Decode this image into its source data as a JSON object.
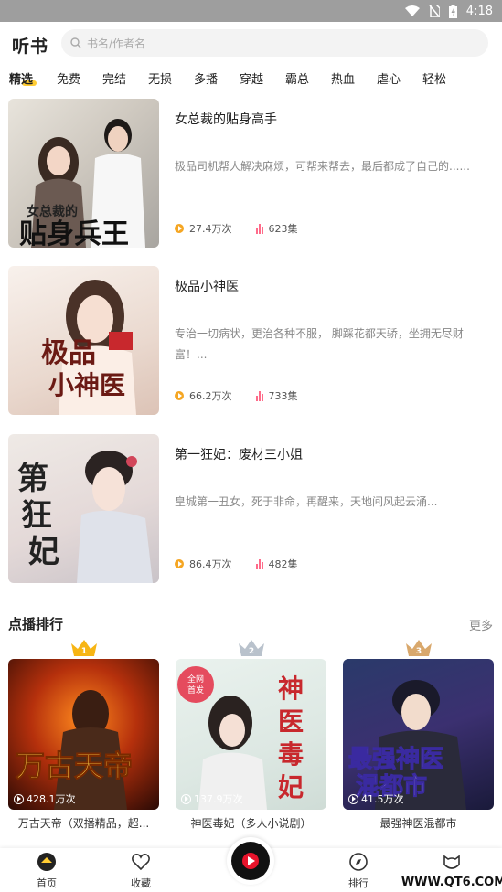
{
  "status_bar": {
    "time": "4:18"
  },
  "header": {
    "logo": "听书",
    "search_placeholder": "书名/作者名"
  },
  "tabs": [
    "精选",
    "免费",
    "完结",
    "无损",
    "多播",
    "穿越",
    "霸总",
    "热血",
    "虐心",
    "轻松"
  ],
  "books": [
    {
      "title": "女总裁的贴身高手",
      "description": "极品司机帮人解决麻烦，可帮来帮去，最后都成了自己的......",
      "plays": "27.4万次",
      "episodes": "623集",
      "cover_text": "女总裁的 贴身兵王"
    },
    {
      "title": "极品小神医",
      "description": "专治一切病状，更治各种不服， 脚踩花都天骄，坐拥无尽财富！...",
      "plays": "66.2万次",
      "episodes": "733集",
      "cover_text": "极品 小神医"
    },
    {
      "title": "第一狂妃：废材三小姐",
      "description": "皇城第一丑女，死于非命，再醒来，天地间风起云涌...",
      "plays": "86.4万次",
      "episodes": "482集",
      "cover_text": "第一狂妃"
    }
  ],
  "ranking": {
    "title": "点播排行",
    "more": "更多",
    "items": [
      {
        "rank": "1",
        "title": "万古天帝（双播精品，超...",
        "plays": "428.1万次",
        "cover_text": "万古天帝"
      },
      {
        "rank": "2",
        "title": "神医毒妃（多人小说剧）",
        "plays": "137.9万次",
        "cover_text": "神医毒妃",
        "badge": "全网 首发"
      },
      {
        "rank": "3",
        "title": "最强神医混都市",
        "plays": "41.5万次",
        "cover_text": "最强神医 混都市"
      }
    ]
  },
  "tabbar": {
    "home": "首页",
    "favorites": "收藏",
    "rank": "排行"
  },
  "watermark": "WWW.QT6.COM",
  "colors": {
    "accent": "#ffcc33",
    "tab_active_bg": "#ffcc33",
    "play_icon": "#f5a623",
    "episode_icon": "#ff6b8a",
    "center_button": "#e8132b"
  }
}
